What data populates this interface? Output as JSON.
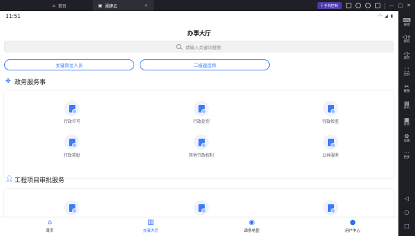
{
  "window": {
    "tabs": [
      {
        "label": "首页",
        "active": false
      },
      {
        "label": "湘建云",
        "active": true
      }
    ],
    "phone_control_label": "手机控制"
  },
  "emulator_sidebar": {
    "items": [
      {
        "label": "按键",
        "icon": "keyboard-icon"
      },
      {
        "label": "加音",
        "icon": "volume-up-icon"
      },
      {
        "label": "减音",
        "icon": "volume-down-icon"
      },
      {
        "label": "全屏",
        "icon": "fullscreen-icon"
      },
      {
        "label": "截图",
        "icon": "scissors-icon"
      },
      {
        "label": "多开",
        "icon": "multi-instance-icon"
      },
      {
        "label": "安装",
        "icon": "install-icon"
      },
      {
        "label": "设置",
        "icon": "settings-icon"
      },
      {
        "label": "更多",
        "icon": "more-icon"
      }
    ]
  },
  "status_bar": {
    "time": "11:51"
  },
  "page": {
    "title": "办事大厅",
    "search_placeholder": "请输入关键词搜索"
  },
  "pills": [
    "关键岗位人员",
    "二级建造师"
  ],
  "sections": [
    {
      "title": "政务服务事",
      "items": [
        "行政许可",
        "行政处罚",
        "行政检查",
        "行政奖励",
        "其他行政权利",
        "公共服务"
      ]
    },
    {
      "title": "工程项目审批服务",
      "items": [
        "",
        "",
        ""
      ]
    }
  ],
  "bottom_nav": [
    {
      "label": "首页",
      "icon": "home-icon",
      "active": false
    },
    {
      "label": "办事大厅",
      "icon": "building-icon",
      "active": true
    },
    {
      "label": "政务地图",
      "icon": "map-pin-icon",
      "active": false
    },
    {
      "label": "用户中心",
      "icon": "user-icon",
      "active": false
    }
  ],
  "colors": {
    "accent": "#3d7bf7",
    "window_bg": "#1e1f24",
    "phone_control": "#4d3aa8"
  }
}
